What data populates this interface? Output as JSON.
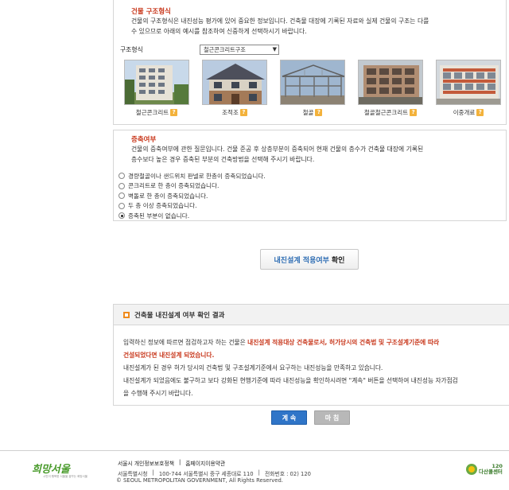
{
  "structure_section": {
    "title": "건물 구조형식",
    "desc_line1": "건물의 구조형식은 내진성능 평가에 있어 중요한 정보입니다. 건축물 대장에 기록된 자료와 실제 건물의 구조는 다를",
    "desc_line2": "수 있으므로 아래의 예시를 참조하여 신중하게 선택하시기 바랍니다.",
    "select_label": "구조형식",
    "select_value": "철근콘크리트구조",
    "options": [
      {
        "label": "철근콘크리트"
      },
      {
        "label": "조적조"
      },
      {
        "label": "철골"
      },
      {
        "label": "철골철근콘크리트"
      },
      {
        "label": "이중개료"
      }
    ],
    "help_glyph": "?"
  },
  "extension_section": {
    "title": "증축여부",
    "desc_line1": "건물의 증축여부에 관한 질문입니다. 건물 준공 후 상층부분이 증축되어 현재 건물의 층수가 건축물 대장에 기록된",
    "desc_line2": "층수보다 높은 경우 증축된 부분의 건축방법을 선택해 주시기 바랍니다.",
    "options": [
      {
        "label": "경량철골이나 샌드위치 판넬로 한층이 증축되었습니다.",
        "selected": false
      },
      {
        "label": "콘크리트로 한 층이 증축되었습니다.",
        "selected": false
      },
      {
        "label": "벽돌로 한 층이 증축되었습니다.",
        "selected": false
      },
      {
        "label": "두 층 이상 증축되었습니다.",
        "selected": false
      },
      {
        "label": "증축된 부분이 없습니다.",
        "selected": true
      }
    ]
  },
  "confirm_button": {
    "part1": "내진설계 적용여부",
    "part2": "확인"
  },
  "result": {
    "title": "건축물 내진설계 여부 확인 결과",
    "p1_a": "입력하신 정보에 따르면 점검하고자 하는 건물은 ",
    "p1_red1": "내진설계 적용대상 건축물로서, 허가당시의 건축법 및 구조설계기준에 따라",
    "p1_red2": "건설되었다면 내진설계 되었습니다.",
    "p2": "내진설계가 된 경우 허가 당시의 건축법 및 구조설계기준에서 요구하는 내진성능을 만족하고 있습니다.",
    "p3_line1": "내진설계가 되었음에도 불구하고 보다 강화된 현행기준에 따라 내진성능을 확인하시려면 \"계속\" 버튼을 선택하여 내진성능 자가점검",
    "p3_line2": "을 수행해 주시기 바랍니다."
  },
  "buttons": {
    "continue": "계 속",
    "finish": "마 침"
  },
  "footer": {
    "logo_text": "희망서울",
    "logo_sub": "시민이 행복한 서울을 꿈꾸는 희망서울",
    "link1": "서울시 개인정보보호정책",
    "link2": "홈페이지이용약관",
    "sep": "|",
    "addr1": "서울특별시청",
    "addr2": "100-744 서울특별시 중구 세종대로 110",
    "addr3": "전화번호 : 02) 120",
    "copyright": "© SEOUL METROPOLITAN GOVERNMENT, All Rights Reserved.",
    "dasan_num": "120",
    "dasan_name": "다산콜센터"
  },
  "colors": {
    "accent_red": "#c8371b",
    "accent_blue": "#2f75c8",
    "accent_orange": "#ef8a1c"
  }
}
